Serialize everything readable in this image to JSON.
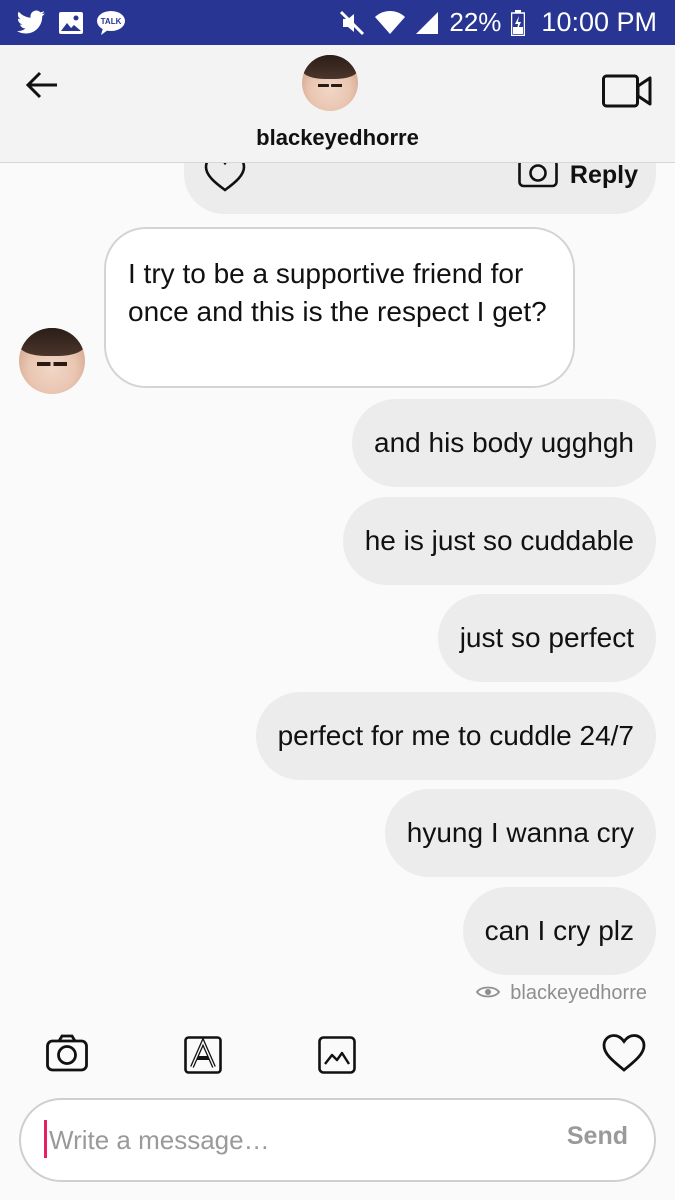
{
  "status_bar": {
    "battery_pct": "22%",
    "time": "10:00 PM",
    "left_icons": [
      "twitter-icon",
      "gallery-icon",
      "kakaotalk-icon"
    ],
    "right_icons": [
      "mute-icon",
      "wifi-icon",
      "signal-icon",
      "battery-icon"
    ],
    "talk_label": "TALK"
  },
  "header": {
    "username": "blackeyedhorre"
  },
  "story_reply": {
    "reply_label": "Reply"
  },
  "messages": {
    "incoming": [
      {
        "text": "I try to be a supportive friend for once and this is the respect I get?"
      }
    ],
    "outgoing": [
      {
        "text": "and his body ugghgh"
      },
      {
        "text": "he is just so cuddable"
      },
      {
        "text": "just so perfect"
      },
      {
        "text": "perfect for me to cuddle 24/7"
      },
      {
        "text": "hyung I wanna cry"
      },
      {
        "text": "can I cry plz"
      }
    ]
  },
  "seen": {
    "label": "blackeyedhorre"
  },
  "composer": {
    "placeholder": "Write a message…",
    "value": "",
    "send_label": "Send"
  },
  "colors": {
    "status_bar": "#283593",
    "bubble_out": "#ececec",
    "cursor": "#e91e63"
  }
}
